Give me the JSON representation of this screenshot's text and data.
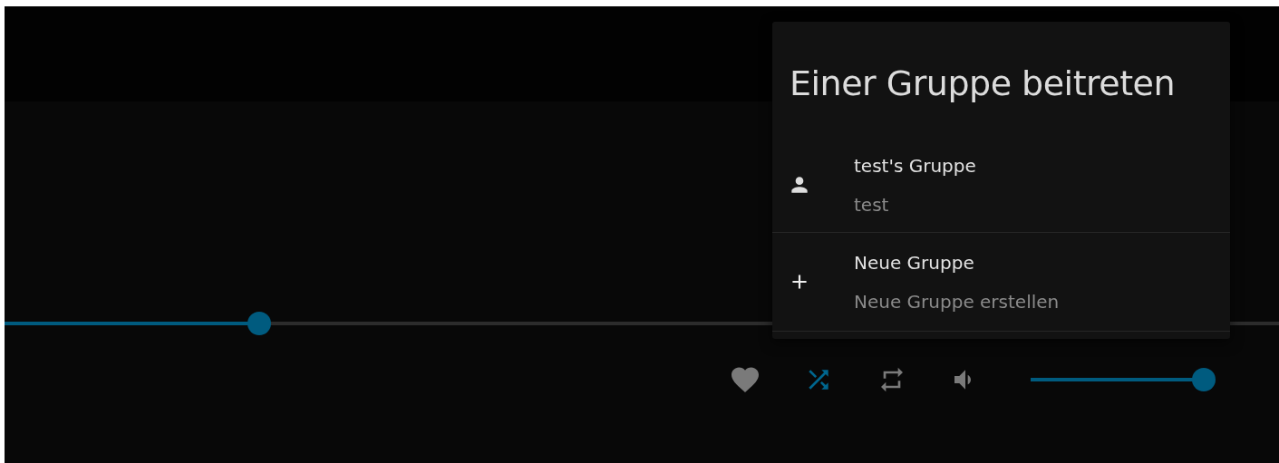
{
  "progress": {
    "level": 0.2
  },
  "controls": [
    {
      "kind": "favorite",
      "on": false
    },
    {
      "kind": "shuffle",
      "on": true
    },
    {
      "kind": "repeat",
      "on": false
    },
    {
      "kind": "volume",
      "on": false
    }
  ],
  "volume": {
    "level": 1
  },
  "dialog": {
    "title": "Einer Gruppe beitreten",
    "items": [
      {
        "kind": "person",
        "title": "test's Gruppe",
        "subtitle": "test"
      },
      {
        "kind": "add",
        "title": "Neue Gruppe",
        "subtitle": "Neue Gruppe erstellen"
      }
    ]
  }
}
